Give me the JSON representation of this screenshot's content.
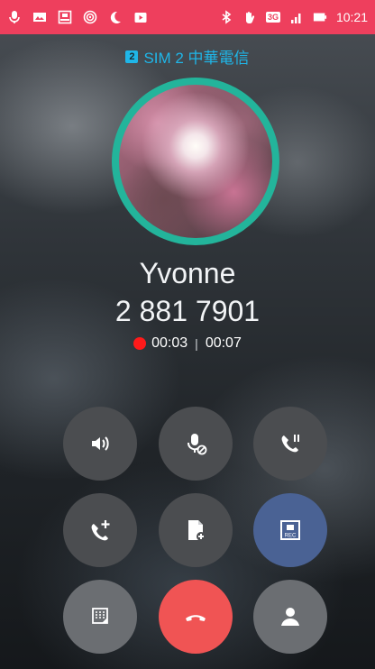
{
  "status_bar": {
    "network_type": "3G",
    "time": "10:21",
    "icons": [
      "mic-icon",
      "image-icon",
      "rec-icon",
      "wireless-icon",
      "moon-icon",
      "play-store-icon",
      "bluetooth-icon",
      "hand-icon",
      "signal-icon",
      "battery-icon"
    ]
  },
  "call": {
    "sim_badge": "2",
    "sim_label": "SIM 2  中華電信",
    "caller_name": "Yvonne",
    "caller_number": "2 881 7901",
    "recording_time": "00:03",
    "separator": "|",
    "call_duration": "00:07"
  },
  "controls": {
    "row1": [
      "speaker-button",
      "mute-button",
      "hold-button"
    ],
    "row2": [
      "add-call-button",
      "note-button",
      "record-button"
    ],
    "row3": [
      "dialpad-button",
      "end-call-button",
      "contact-button"
    ]
  },
  "colors": {
    "status_bar": "#ee3f5d",
    "sim_label": "#1fb6e8",
    "avatar_ring": "#23b49b",
    "record_dot": "#ff1a1a",
    "record_button": "#4a6294",
    "end_call": "#f05454"
  }
}
